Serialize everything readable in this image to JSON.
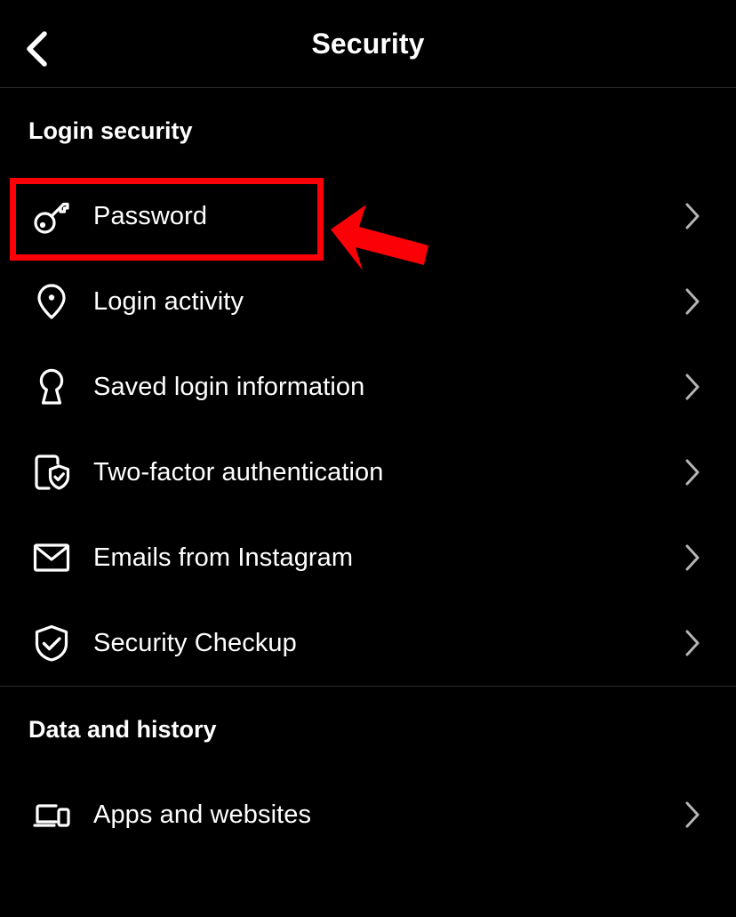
{
  "app": {
    "screen_title": "Security",
    "theme_background": "#000000",
    "text_color": "#ffffff",
    "chevron_color": "#b4b4b4",
    "divider_color": "#2b2b2b",
    "annotation_color": "#fb0007"
  },
  "header": {
    "title": "Security",
    "back_icon": "chevron-left-icon"
  },
  "sections": [
    {
      "title": "Login security",
      "rows": [
        {
          "label": "Password",
          "icon": "key-icon",
          "chevron": "chevron-right-icon",
          "highlighted": true
        },
        {
          "label": "Login activity",
          "icon": "location-pin-icon",
          "chevron": "chevron-right-icon",
          "highlighted": false
        },
        {
          "label": "Saved login information",
          "icon": "keyhole-icon",
          "chevron": "chevron-right-icon",
          "highlighted": false
        },
        {
          "label": "Two-factor authentication",
          "icon": "phone-shield-check-icon",
          "chevron": "chevron-right-icon",
          "highlighted": false
        },
        {
          "label": "Emails from Instagram",
          "icon": "envelope-icon",
          "chevron": "chevron-right-icon",
          "highlighted": false
        },
        {
          "label": "Security Checkup",
          "icon": "shield-check-icon",
          "chevron": "chevron-right-icon",
          "highlighted": false
        }
      ]
    },
    {
      "title": "Data and history",
      "rows": [
        {
          "label": "Apps and websites",
          "icon": "devices-icon",
          "chevron": "chevron-right-icon",
          "highlighted": false
        }
      ]
    }
  ],
  "annotations": {
    "highlight_target": "Password",
    "highlight_shape": "rectangle-outline",
    "highlight_color": "#fb0007",
    "arrow_icon": "arrow-left-icon",
    "arrow_color": "#fb0007",
    "arrow_points_to": "Password"
  }
}
